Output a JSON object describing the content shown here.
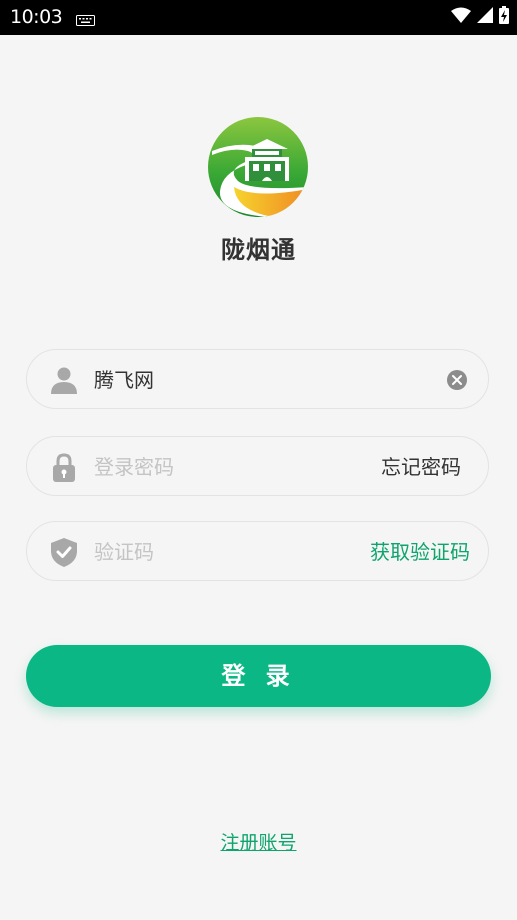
{
  "status_bar": {
    "time": "10:03"
  },
  "app": {
    "name": "陇烟通"
  },
  "form": {
    "username": {
      "value": "腾飞网"
    },
    "password": {
      "placeholder": "登录密码",
      "forgot_label": "忘记密码"
    },
    "captcha": {
      "placeholder": "验证码",
      "get_code_label": "获取验证码"
    },
    "login_label": "登 录",
    "register_label": "注册账号"
  },
  "colors": {
    "accent": "#0bb784",
    "link": "#0fa46d",
    "background": "#f5f5f5",
    "placeholder": "#c4c4c4"
  }
}
